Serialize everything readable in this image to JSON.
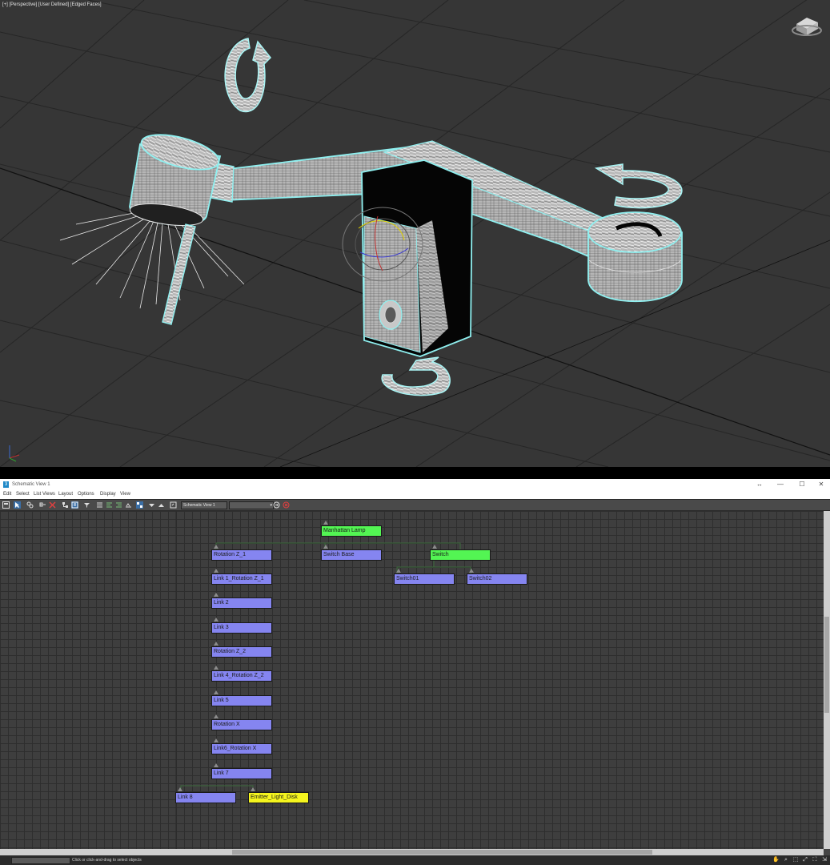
{
  "viewport": {
    "label_plus": "[+]",
    "label_view": "[Perspective]",
    "label_shading": "[User Defined]",
    "label_edges": "[Edged Faces]",
    "grid_color": "#2a2a2a",
    "background_color": "#363636",
    "selection_color": "#8ff0f0"
  },
  "schematic": {
    "window_title": "Schematic View 1",
    "window_buttons": {
      "restore": "↔",
      "minimize": "—",
      "maximize": "☐",
      "close": "✕"
    },
    "menus": [
      "Edit",
      "Select",
      "List Views",
      "Layout",
      "Options",
      "Display",
      "View"
    ],
    "view_name": "Schematic View 1",
    "search_value": "",
    "status_text": "Click or click-and-drag to select objects",
    "colors": {
      "object_node": "#8585f0",
      "helper_node": "#53f553",
      "light_node": "#f5f51e"
    },
    "nodes": [
      {
        "label": "Manhattan Lamp",
        "kind": "helper"
      },
      {
        "label": "Rotation Z_1",
        "kind": "object"
      },
      {
        "label": "Switch Base",
        "kind": "object"
      },
      {
        "label": "Switch",
        "kind": "helper"
      },
      {
        "label": "Link 1_Rotation Z_1",
        "kind": "object"
      },
      {
        "label": "Switch01",
        "kind": "object"
      },
      {
        "label": "Switch02",
        "kind": "object"
      },
      {
        "label": "Link 2",
        "kind": "object"
      },
      {
        "label": "Link 3",
        "kind": "object"
      },
      {
        "label": "Rotation Z_2",
        "kind": "object"
      },
      {
        "label": "Link 4_Rotation Z_2",
        "kind": "object"
      },
      {
        "label": "Link 5",
        "kind": "object"
      },
      {
        "label": "Rotation X",
        "kind": "object"
      },
      {
        "label": "Link6_Rotation X",
        "kind": "object"
      },
      {
        "label": "Link 7",
        "kind": "object"
      },
      {
        "label": "Link 8",
        "kind": "object"
      },
      {
        "label": "Emitter_Light_Disk",
        "kind": "light"
      }
    ]
  }
}
